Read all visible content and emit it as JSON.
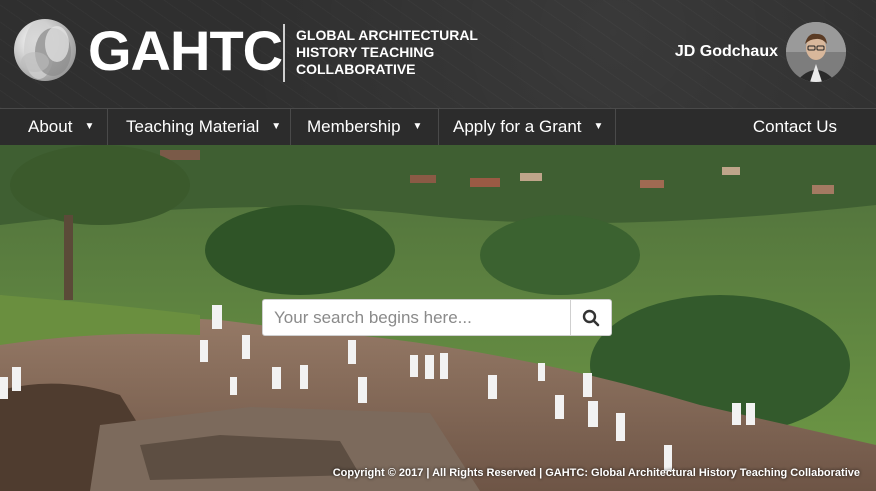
{
  "brand": {
    "logo_text": "GAHTC",
    "tagline_lines": [
      "GLOBAL ARCHITECTURAL",
      "HISTORY TEACHING",
      "COLLABORATIVE"
    ]
  },
  "user": {
    "name": "JD Godchaux"
  },
  "nav": {
    "items": [
      {
        "label": "About",
        "has_dropdown": true
      },
      {
        "label": "Teaching Material",
        "has_dropdown": true
      },
      {
        "label": "Membership",
        "has_dropdown": true
      },
      {
        "label": "Apply for a Grant",
        "has_dropdown": true
      }
    ],
    "contact": "Contact Us",
    "dropdown_icon": "caret-down-icon"
  },
  "search": {
    "placeholder": "Your search begins here...",
    "button_icon": "search-icon"
  },
  "footer": {
    "copyright": "Copyright © 2017 | All Rights Reserved | GAHTC: Global Architectural History Teaching Collaborative"
  },
  "colors": {
    "header_bg": "#2f2f2f",
    "nav_bg": "#2c2c2c",
    "text": "#ffffff"
  }
}
